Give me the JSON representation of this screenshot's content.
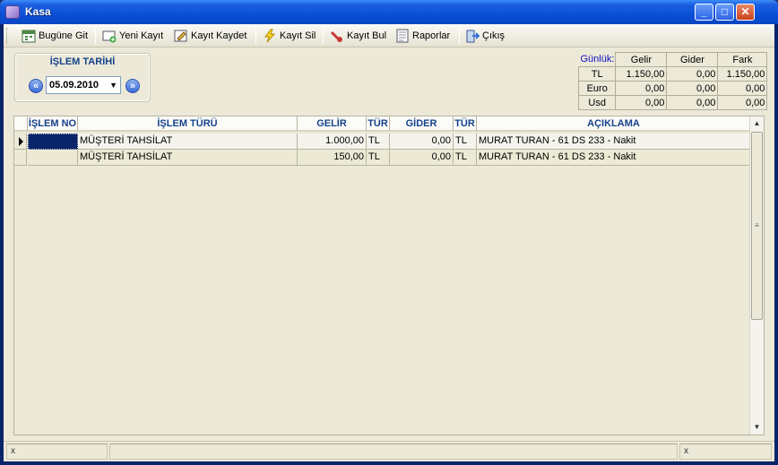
{
  "window": {
    "title": "Kasa"
  },
  "toolbar": {
    "items": [
      {
        "label": "Bugüne Git",
        "icon": "calendar-icon"
      },
      {
        "label": "Yeni Kayıt",
        "icon": "new-record-icon"
      },
      {
        "label": "Kayıt Kaydet",
        "icon": "save-icon"
      },
      {
        "label": "Kayıt Sil",
        "icon": "lightning-icon"
      },
      {
        "label": "Kayıt Bul",
        "icon": "find-icon"
      },
      {
        "label": "Raporlar",
        "icon": "report-icon"
      },
      {
        "label": "Çıkış",
        "icon": "exit-door-icon"
      }
    ]
  },
  "date_panel": {
    "label": "İŞLEM TARİHİ",
    "value": "05.09.2010"
  },
  "summary": {
    "label": "Günlük:",
    "headers": [
      "Gelir",
      "Gider",
      "Fark"
    ],
    "rows": [
      {
        "currency": "TL",
        "gelir": "1.150,00",
        "gider": "0,00",
        "fark": "1.150,00"
      },
      {
        "currency": "Euro",
        "gelir": "0,00",
        "gider": "0,00",
        "fark": "0,00"
      },
      {
        "currency": "Usd",
        "gelir": "0,00",
        "gider": "0,00",
        "fark": "0,00"
      }
    ]
  },
  "grid": {
    "columns": [
      "İŞLEM NO",
      "İŞLEM TÜRÜ",
      "GELİR",
      "TÜR",
      "GİDER",
      "TÜR",
      "AÇIKLAMA"
    ],
    "rows": [
      {
        "no": "",
        "type": "MÜŞTERİ TAHSİLAT",
        "gelir": "1.000,00",
        "tur1": "TL",
        "gider": "0,00",
        "tur2": "TL",
        "desc": "MURAT TURAN - 61 DS 233 - Nakit"
      },
      {
        "no": "",
        "type": "MÜŞTERİ TAHSİLAT",
        "gelir": "150,00",
        "tur1": "TL",
        "gider": "0,00",
        "tur2": "TL",
        "desc": "MURAT TURAN - 61 DS 233 - Nakit"
      }
    ]
  },
  "statusbar": {
    "left": "x",
    "right": "x"
  }
}
